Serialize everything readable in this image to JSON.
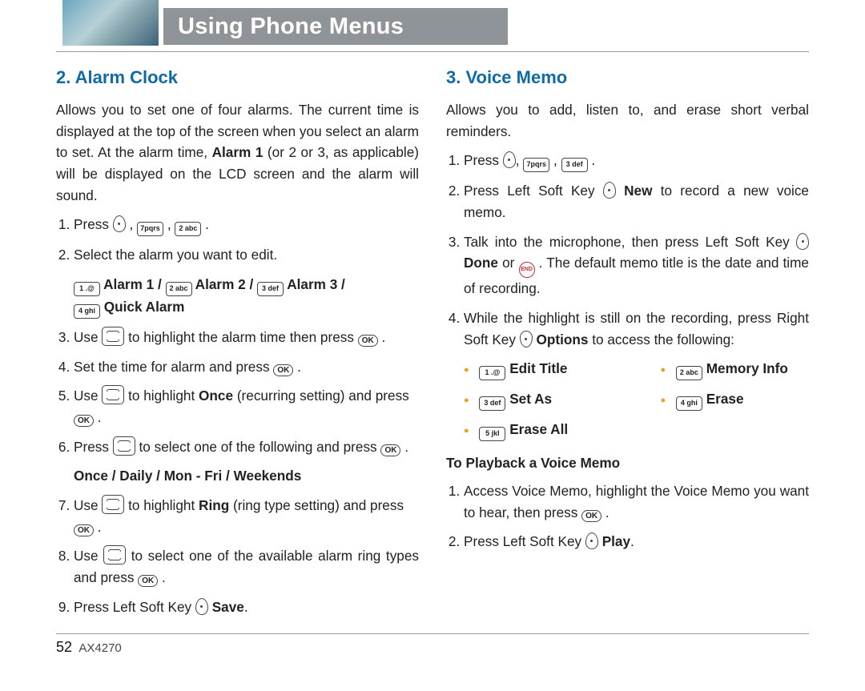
{
  "header": {
    "title": "Using Phone Menus"
  },
  "left": {
    "heading": "2. Alarm Clock",
    "intro_a": "Allows you to set one of four alarms. The current time is displayed at the top of the screen when you select an alarm to set. At the alarm time, ",
    "intro_b": "Alarm 1",
    "intro_c": " (or 2 or 3, as applicable) will be displayed on the LCD screen and the alarm will sound.",
    "step1": "Press ",
    "step2": "Select the alarm you want to edit.",
    "alarm1": "Alarm 1 /",
    "alarm2": "Alarm 2 /",
    "alarm3": "Alarm 3 /",
    "quick": "Quick Alarm",
    "step3a": "Use ",
    "step3b": " to highlight the alarm time then press ",
    "step4": "Set the time for alarm and press ",
    "step5a": "Use ",
    "step5b": " to highlight ",
    "step5c": "Once",
    "step5d": " (recurring setting) and press ",
    "step6a": "Press ",
    "step6b": " to select one of the following and press ",
    "recurring": "Once / Daily / Mon - Fri / Weekends",
    "step7a": "Use ",
    "step7b": " to highlight ",
    "step7c": "Ring",
    "step7d": " (ring type setting) and press ",
    "step8a": "Use ",
    "step8b": " to select one of the available alarm ring types and press ",
    "step9a": "Press Left Soft Key ",
    "step9b": "Save"
  },
  "right": {
    "heading": "3. Voice Memo",
    "intro": "Allows you to add, listen to, and erase short verbal reminders.",
    "step1": "Press ",
    "step2a": "Press Left Soft Key ",
    "step2b": "New",
    "step2c": " to record a new voice memo.",
    "step3a": "Talk into the microphone, then press Left Soft Key ",
    "step3b": "Done",
    "step3c": " or ",
    "step3d": " . The default memo title is the date and time of recording.",
    "step4a": "While the highlight is still on the recording, press Right Soft Key ",
    "step4b": "Options",
    "step4c": " to access the following:",
    "opts": {
      "edit": "Edit Title",
      "set": "Set As",
      "eraseall": "Erase All",
      "memory": "Memory Info",
      "erase": "Erase"
    },
    "playback_head": "To Playback a Voice Memo",
    "pb1": "Access Voice Memo, highlight the Voice Memo you want to hear, then press ",
    "pb2a": "Press Left Soft Key ",
    "pb2b": "Play"
  },
  "keys": {
    "k1": "1 .@",
    "k2": "2 abc",
    "k3": "3 def",
    "k4": "4 ghi",
    "k5": "5 jkl",
    "k7": "7pqrs",
    "ok": "OK",
    "end": "END"
  },
  "footer": {
    "page": "52",
    "model": "AX4270"
  }
}
